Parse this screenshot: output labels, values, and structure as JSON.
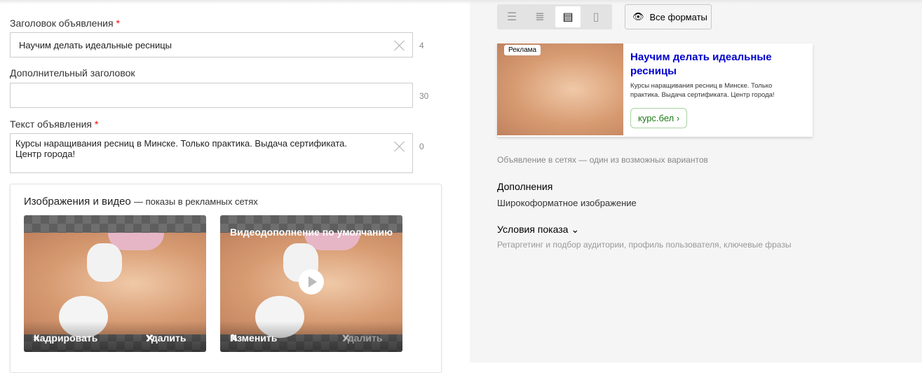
{
  "form": {
    "headline": {
      "label": "Заголовок объявления",
      "required": "*",
      "value": "Научим делать идеальные ресницы",
      "counter": "4"
    },
    "subheadline": {
      "label": "Дополнительный заголовок",
      "value": "",
      "counter": "30"
    },
    "text": {
      "label": "Текст объявления",
      "required": "*",
      "value": "Курсы наращивания ресниц в Минске. Только практика. Выдача сертификата. Центр города!",
      "counter": "0"
    }
  },
  "media": {
    "title": "Изображения и видео",
    "subtitle": "— показы в рекламных сетях",
    "image": {
      "crop": "Кадрировать",
      "delete": "Удалить"
    },
    "video": {
      "title": "Видеодополнение по умолчанию",
      "edit": "Изменить",
      "delete": "Удалить"
    }
  },
  "preview": {
    "all_formats": "Все форматы",
    "ad": {
      "badge": "Реклама",
      "title": "Научим делать идеальные ресницы",
      "text": "Курсы наращивания ресниц в Минске. Только практика. Выдача сертификата. Центр города!",
      "link": "курс.бел",
      "link_arrow": "›"
    },
    "caption": "Объявление в сетях — один из возможных вариантов",
    "extras_title": "Дополнения",
    "extras_value": "Широкоформатное изображение",
    "conditions_title": "Условия показа",
    "conditions_value": "Ретаргетинг и подбор аудитории, профиль пользователя, ключевые фразы"
  }
}
